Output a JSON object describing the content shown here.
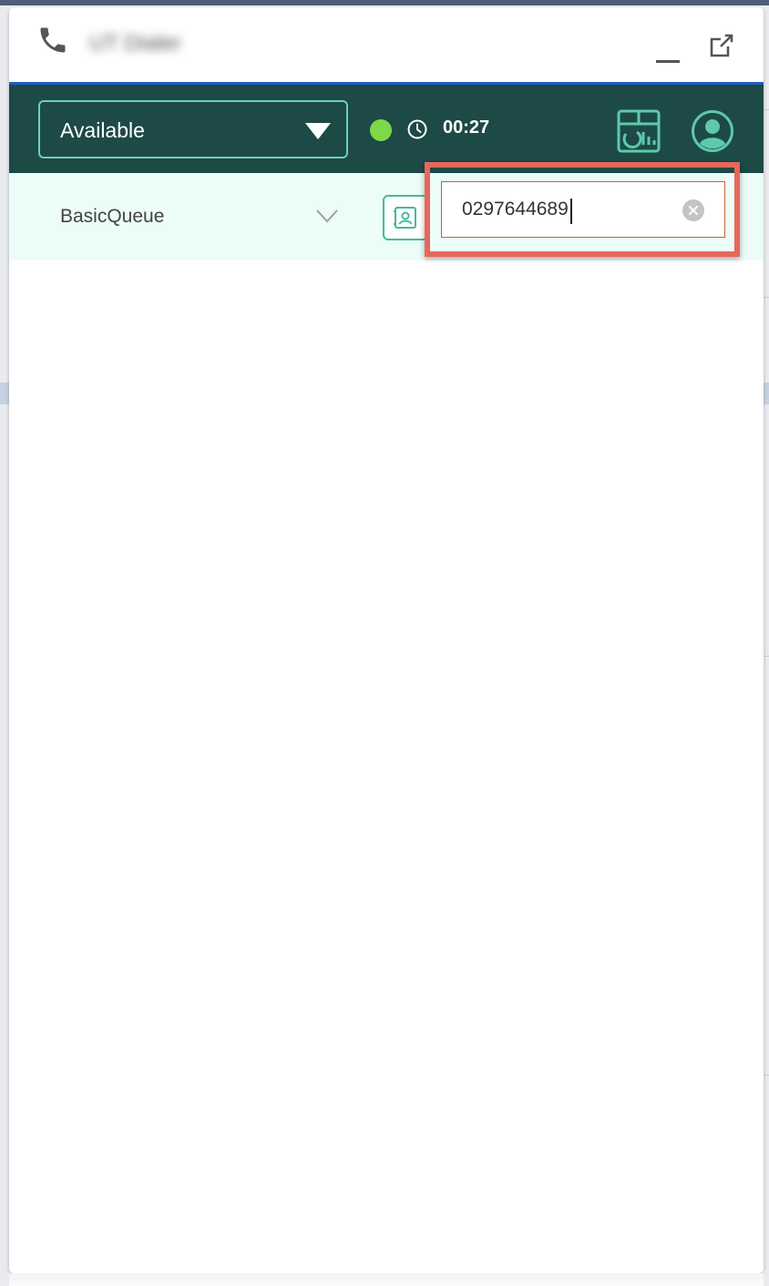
{
  "window": {
    "title": "UT Dialer",
    "minimize_icon": "minimize-icon",
    "popout_icon": "popout-icon"
  },
  "status": {
    "selected": "Available",
    "indicator_color": "#7ed84a",
    "timer": "00:27"
  },
  "queue": {
    "selected": "BasicQueue"
  },
  "dialer": {
    "value": "0297644689",
    "highlight_color": "#e8675a"
  },
  "colors": {
    "header_bg": "#1d4a46",
    "accent": "#6fcfb6",
    "queue_bg": "#ecfcf7",
    "title_accent": "#1f5fbf"
  }
}
